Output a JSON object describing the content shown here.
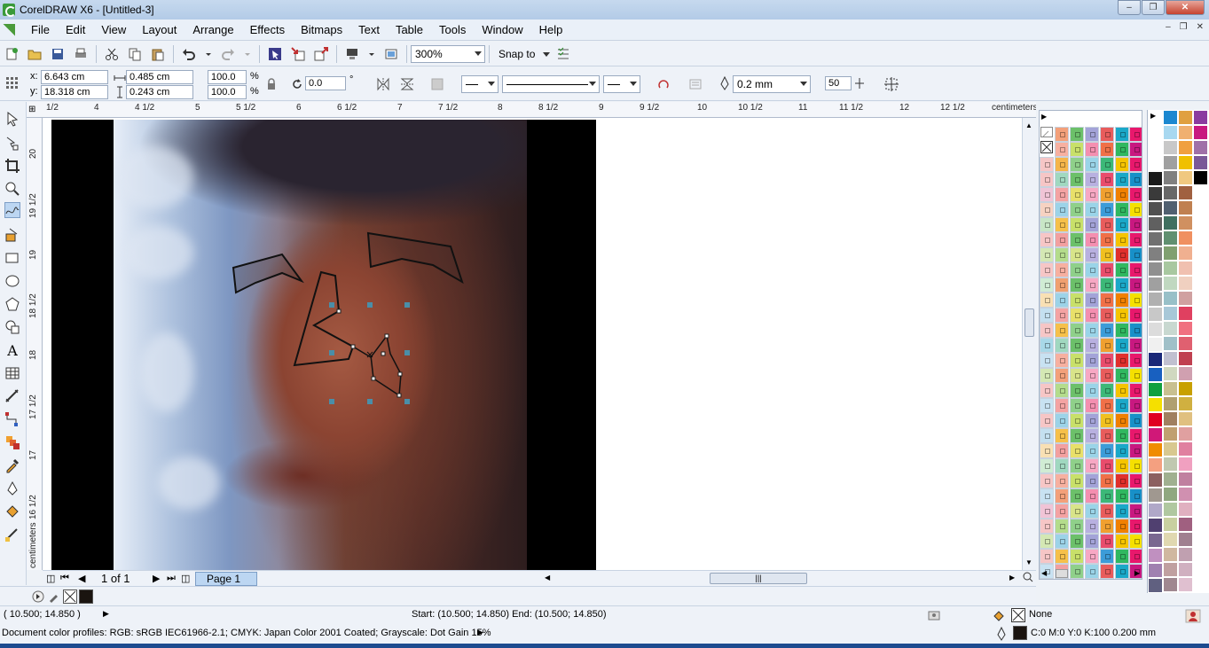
{
  "titlebar": {
    "title": "CorelDRAW X6 - [Untitled-3]",
    "minimize": "‒",
    "restore": "❐",
    "close": "✕"
  },
  "menu": [
    "File",
    "Edit",
    "View",
    "Layout",
    "Arrange",
    "Effects",
    "Bitmaps",
    "Text",
    "Table",
    "Tools",
    "Window",
    "Help"
  ],
  "toolbar": {
    "zoom_level": "300%",
    "snap_label": "Snap to"
  },
  "properties": {
    "x_label": "x:",
    "x_value": "6.643 cm",
    "y_label": "y:",
    "y_value": "18.318 cm",
    "w_value": "0.485 cm",
    "h_value": "0.243 cm",
    "scale_x": "100.0",
    "scale_y": "100.0",
    "pct": "%",
    "angle": "0.0",
    "deg": "°",
    "outline_width": "0.2 mm",
    "smoothness": "50"
  },
  "ruler": {
    "top_labels": [
      "1/2",
      "4",
      "4 1/2",
      "5",
      "5 1/2",
      "6",
      "6 1/2",
      "7",
      "7 1/2",
      "8",
      "8 1/2",
      "9",
      "9 1/2",
      "10",
      "10 1/2",
      "11",
      "11 1/2",
      "12",
      "12 1/2"
    ],
    "units": "centimeters",
    "left_labels": [
      "20",
      "19 1/2",
      "19",
      "18 1/2",
      "18",
      "17 1/2",
      "17",
      "16 1/2"
    ],
    "left_units": "centimeters"
  },
  "page_nav": {
    "counter": "1 of 1",
    "page_tab": "Page 1"
  },
  "status": {
    "cursor": "( 10.500; 14.850 )",
    "start_end": "Start: (10.500; 14.850)  End: (10.500; 14.850)",
    "fill": "None",
    "profiles": "Document color profiles: RGB: sRGB IEC61966-2.1; CMYK: Japan Color 2001 Coated; Grayscale: Dot Gain 15%",
    "outline": "C:0 M:0 Y:0 K:100  0.200 mm"
  },
  "palette_colors": {
    "col1": [
      "#f6c6c6",
      "#c8e2f2",
      "#f6c6c6",
      "#f6c6c6",
      "#f0c4d6",
      "#f6d2c2",
      "#c8e6c6",
      "#f6c6c6",
      "#d4e8b4",
      "#f6c6c6",
      "#d0ecd4",
      "#f8e0b4",
      "#c4e0f0",
      "#f6c6c6",
      "#a8d8e8",
      "#c8e2f2",
      "#d4e8b4",
      "#f6c6c6",
      "#c8e2f2",
      "#f6c6c6",
      "#c4e0f0",
      "#f8e0b4",
      "#d0ecd4",
      "#f6c6c6",
      "#c8e2f2",
      "#f0c4d6",
      "#f6c6c6",
      "#d4e8b4",
      "#f6c6c6",
      "#c8e2f2"
    ],
    "col2": [
      "#f3a07a",
      "#f7b0a0",
      "#f5b54a",
      "#a0d8c0",
      "#f4a3a3",
      "#9cd3e8",
      "#f6c04a",
      "#f2a0a0",
      "#b4dc8c",
      "#f7b0a0",
      "#f0a070",
      "#9cd3e8",
      "#f4a3a3",
      "#f6c04a",
      "#a0d8c0",
      "#f7b0a0",
      "#f3a07a",
      "#b4dc8c",
      "#f4a3a3",
      "#9cd3e8",
      "#f6c04a",
      "#f2a0a0",
      "#a0d8c0",
      "#f7b0a0",
      "#f3a07a",
      "#f4a3a3",
      "#b4dc8c",
      "#9cd3e8",
      "#f6c04a",
      "#f2a0a0"
    ],
    "col3": [
      "#6cc06a",
      "#c8e06a",
      "#8fd08a",
      "#6cc06a",
      "#e8e06a",
      "#8fd08a",
      "#c8e06a",
      "#6cc06a",
      "#d8e48a",
      "#8fd08a",
      "#6cc06a",
      "#c8e06a",
      "#e8e06a",
      "#8fd08a",
      "#6cc06a",
      "#c8e06a",
      "#d8e48a",
      "#6cc06a",
      "#8fd08a",
      "#c8e06a",
      "#6cc06a",
      "#e8e06a",
      "#8fd08a",
      "#c8e06a",
      "#6cc06a",
      "#d8e48a",
      "#8fd08a",
      "#6cc06a",
      "#c8e06a",
      "#8fd08a"
    ],
    "col4": [
      "#a3a3d8",
      "#f48fb0",
      "#9ad4e8",
      "#b8b0e0",
      "#f7a8c4",
      "#9ad4e8",
      "#a3a3d8",
      "#f48fb0",
      "#b8b0e0",
      "#9ad4e8",
      "#f7a8c4",
      "#a3a3d8",
      "#f48fb0",
      "#9ad4e8",
      "#b8b0e0",
      "#a3a3d8",
      "#f7a8c4",
      "#9ad4e8",
      "#f48fb0",
      "#a3a3d8",
      "#b8b0e0",
      "#9ad4e8",
      "#f7a8c4",
      "#a3a3d8",
      "#f48fb0",
      "#9ad4e8",
      "#b8b0e0",
      "#a3a3d8",
      "#f7a8c4",
      "#9ad4e8"
    ],
    "col5": [
      "#e85c5c",
      "#f07048",
      "#3cb878",
      "#e84c6c",
      "#f0a030",
      "#3c9cd8",
      "#e85c5c",
      "#f07048",
      "#f0c020",
      "#e84c6c",
      "#3cb878",
      "#f07048",
      "#e85c5c",
      "#3c9cd8",
      "#f0a030",
      "#e84c6c",
      "#e85c5c",
      "#3cb878",
      "#f07048",
      "#f0c020",
      "#e85c5c",
      "#3c9cd8",
      "#e84c6c",
      "#f07048",
      "#3cb878",
      "#e85c5c",
      "#f0a030",
      "#e84c6c",
      "#3c9cd8",
      "#e85c5c"
    ],
    "col6": [
      "#1aa8c8",
      "#30b860",
      "#f5c400",
      "#1aa8c8",
      "#f08000",
      "#30b860",
      "#1aa8c8",
      "#f5c400",
      "#e0302c",
      "#30b860",
      "#1aa8c8",
      "#f08000",
      "#f5c400",
      "#30b860",
      "#1aa8c8",
      "#e0302c",
      "#30b860",
      "#f5c400",
      "#1aa8c8",
      "#f08000",
      "#30b860",
      "#1aa8c8",
      "#f5c400",
      "#e0302c",
      "#30b860",
      "#1aa8c8",
      "#f08000",
      "#f5c400",
      "#30b860",
      "#1aa8c8"
    ],
    "col7": [
      "#e8186c",
      "#c81880",
      "#e8186c",
      "#1890c8",
      "#e8186c",
      "#f5e000",
      "#c81880",
      "#e8186c",
      "#1890c8",
      "#e8186c",
      "#c81880",
      "#f5e000",
      "#e8186c",
      "#1890c8",
      "#c81880",
      "#e8186c",
      "#f5e000",
      "#e8186c",
      "#c81880",
      "#1890c8",
      "#e8186c",
      "#c81880",
      "#f5e000",
      "#e8186c",
      "#1890c8",
      "#c81880",
      "#e8186c",
      "#f5e000",
      "#e8186c",
      "#c81880"
    ],
    "col8": [
      "#1870b8",
      "#8a3ca0",
      "#1870b8",
      "#8a3ca0",
      "#1870b8",
      "#8a3ca0",
      "#1870b8",
      "#8a3ca0",
      "#1870b8",
      "#8a3ca0",
      "#1870b8",
      "#8a3ca0",
      "#1870b8",
      "#8a3ca0",
      "#1870b8",
      "#8a3ca0",
      "#1870b8",
      "#8a3ca0",
      "#1870b8",
      "#8a3ca0",
      "#1870b8",
      "#8a3ca0",
      "#1870b8",
      "#8a3ca0",
      "#1870b8",
      "#8a3ca0",
      "#1870b8",
      "#8a3ca0",
      "#1870b8",
      "#8a3ca0"
    ]
  },
  "palette2_colors": {
    "c1": [
      "#ffffff",
      "#ffffff",
      "#ffffff",
      "#1a1a1a",
      "#3a3a3a",
      "#505050",
      "#606060",
      "#707070",
      "#808080",
      "#909090",
      "#a0a0a0",
      "#b0b0b0",
      "#c8c8c8",
      "#dcdcdc",
      "#f0f0f0",
      "#1a2878",
      "#1860c0",
      "#10a040",
      "#f5e000",
      "#e00020",
      "#d01878",
      "#f08c00",
      "#f4a080",
      "#8c6060",
      "#a09890",
      "#b0a8c8",
      "#504070",
      "#7a6890",
      "#c090c0",
      "#a080b0",
      "#606080",
      "#807890"
    ],
    "c2": [
      "#1c88d0",
      "#a8d8f0",
      "#c8c8c8",
      "#a0a0a0",
      "#808080",
      "#686868",
      "#506070",
      "#407060",
      "#609070",
      "#80a070",
      "#a8c8a0",
      "#c0d8c0",
      "#98c0c8",
      "#a8c8d8",
      "#c8d8d0",
      "#a0c0c8",
      "#c0c0d0",
      "#d0d8c0",
      "#c8c090",
      "#b0a070",
      "#a08060",
      "#c0a070",
      "#d8c890",
      "#c0c8b0",
      "#a0b090",
      "#90a880",
      "#b0c8a0",
      "#c8d0a0",
      "#e0d8b0",
      "#d0b8a0",
      "#c0a0a0",
      "#a08890"
    ],
    "c3": [
      "#e0a040",
      "#f0b070",
      "#f0a040",
      "#f0c000",
      "#f0c880",
      "#a06040",
      "#c08050",
      "#d09060",
      "#f09060",
      "#f0b090",
      "#f0c0b0",
      "#f0d0c0",
      "#d0a0a0",
      "#e04060",
      "#f07080",
      "#e06070",
      "#c04050",
      "#d0a0b0",
      "#c8a000",
      "#d0b040",
      "#e0c080",
      "#e0a0a0",
      "#e080a0",
      "#f0a0c0",
      "#c080a0",
      "#d090b0",
      "#e0b0c0",
      "#a06080",
      "#a08090",
      "#c0a0b0",
      "#d0b0c0",
      "#e0c0d0"
    ],
    "c4": [
      "#8a3ca0",
      "#c81880",
      "#a070a8",
      "#7a5898",
      "#000000",
      "#ffffff",
      "#ffffff",
      "#ffffff",
      "#ffffff",
      "#ffffff",
      "#ffffff",
      "#ffffff",
      "#ffffff",
      "#ffffff",
      "#ffffff",
      "#ffffff",
      "#ffffff",
      "#ffffff",
      "#ffffff",
      "#ffffff",
      "#ffffff",
      "#ffffff",
      "#ffffff",
      "#ffffff",
      "#ffffff",
      "#ffffff",
      "#ffffff",
      "#ffffff",
      "#ffffff",
      "#ffffff",
      "#ffffff",
      "#ffffff"
    ]
  }
}
